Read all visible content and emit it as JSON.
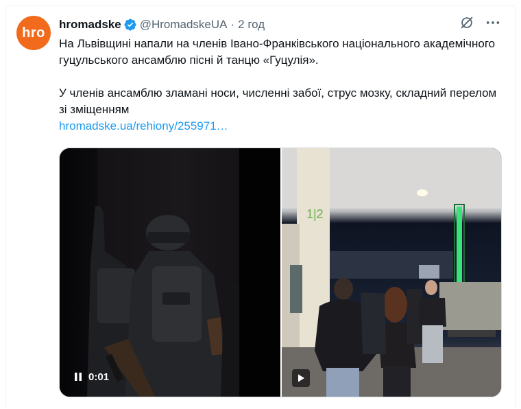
{
  "tweet": {
    "avatar_text": "hro",
    "name": "hromadske",
    "handle": "@HromadskeUA",
    "separator": "·",
    "time": "2 год",
    "paragraph1": "На Львівщині напали на членів Івано-Франківського національного академічного гуцульського ансамблю пісні й танцю «Гуцулія».",
    "paragraph2": "У членів ансамблю зламані носи, численні забої, струс мозку, складний перелом зі зміщенням",
    "link": "hromadske.ua/rehiony/255971…"
  },
  "media": {
    "video1_time": "0:01",
    "video1_state": "pause-icon",
    "video2_state": "play-icon",
    "station_sign": "1|2"
  },
  "colors": {
    "brand": "#f26b1d",
    "link": "#1d9bf0",
    "verified": "#1d9bf0",
    "muted": "#536471"
  }
}
